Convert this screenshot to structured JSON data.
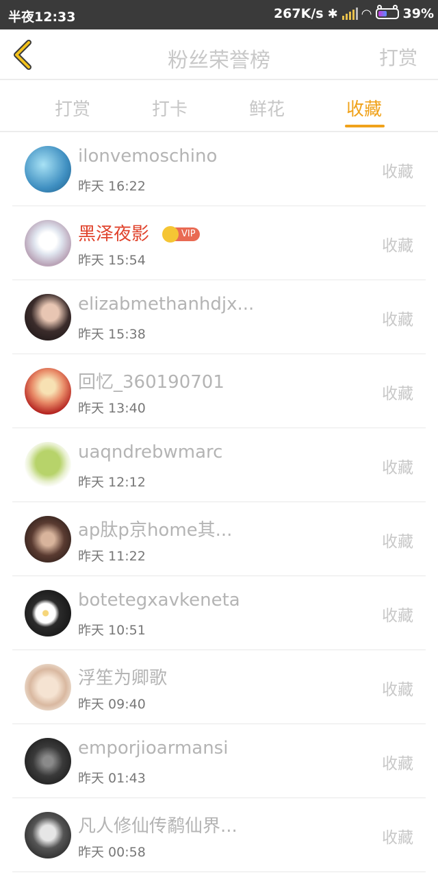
{
  "status_bar": {
    "time": "半夜12:33",
    "net_speed": "267K/s",
    "battery": "39%"
  },
  "nav": {
    "title": "粉丝荣誉榜",
    "right_action": "打赏",
    "back_icon": "chevron-left-icon"
  },
  "tabs": [
    {
      "label": "打赏"
    },
    {
      "label": "打卡"
    },
    {
      "label": "鲜花"
    },
    {
      "label": "收藏",
      "active": true
    }
  ],
  "colors": {
    "accent": "#f0a21a",
    "vip_name": "#e0432c",
    "status_bar": "#3a3a3a"
  },
  "rows": [
    {
      "name": "ilonvemoschino",
      "time": "昨天 16:22",
      "action": "收藏"
    },
    {
      "name": "黑泽夜影",
      "time": "昨天 15:54",
      "action": "收藏",
      "vip": "VIP"
    },
    {
      "name": "elizabmethanhdjx...",
      "time": "昨天 15:38",
      "action": "收藏"
    },
    {
      "name": "回忆_360190701",
      "time": "昨天 13:40",
      "action": "收藏"
    },
    {
      "name": "uaqndrebwmarc",
      "time": "昨天 12:12",
      "action": "收藏"
    },
    {
      "name": "ap肽p京home其...",
      "time": "昨天 11:22",
      "action": "收藏"
    },
    {
      "name": "botetegxavkeneta",
      "time": "昨天 10:51",
      "action": "收藏"
    },
    {
      "name": "浮笙为卿歌",
      "time": "昨天 09:40",
      "action": "收藏"
    },
    {
      "name": "emporjioarmansi",
      "time": "昨天 01:43",
      "action": "收藏"
    },
    {
      "name": "凡人修仙传鹬仙界...",
      "time": "昨天 00:58",
      "action": "收藏"
    }
  ]
}
